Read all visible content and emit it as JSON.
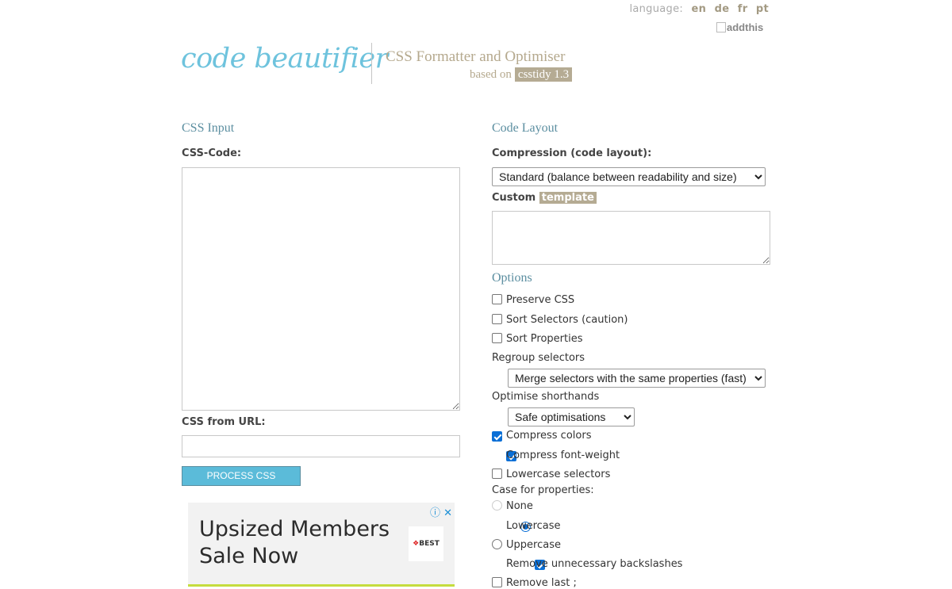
{
  "language": {
    "label": "language:",
    "options": [
      "en",
      "de",
      "fr",
      "pt"
    ]
  },
  "addthis": {
    "alt": "addthis"
  },
  "header": {
    "logo": "code beautifier",
    "subtitle": "CSS Formatter and Optimiser",
    "based_on": "based on",
    "based_tag": "csstidy 1.3"
  },
  "input": {
    "heading": "CSS Input",
    "code_label": "CSS-Code:",
    "code_value": "",
    "url_label": "CSS from URL:",
    "url_value": "",
    "process_button": "PROCESS CSS"
  },
  "ad": {
    "title": "Upsized Members Sale Now",
    "brand": "BEST",
    "info_icon": "info-icon",
    "close_icon": "close-icon"
  },
  "layout": {
    "heading": "Code Layout",
    "compression_label": "Compression (code layout):",
    "compression_selected": "Standard (balance between readability and size)",
    "custom_label": "Custom",
    "custom_tag": "template",
    "custom_value": ""
  },
  "options": {
    "heading": "Options",
    "preserve_css": {
      "label": "Preserve CSS",
      "checked": false
    },
    "sort_selectors": {
      "label": "Sort Selectors (caution)",
      "checked": false
    },
    "sort_properties": {
      "label": "Sort Properties",
      "checked": false
    },
    "regroup_label": "Regroup selectors",
    "regroup_selected": "Merge selectors with the same properties (fast)",
    "optimise_label": "Optimise shorthands",
    "optimise_selected": "Safe optimisations",
    "compress_colors": {
      "label": "Compress colors",
      "checked": true
    },
    "compress_font_weight": {
      "label": "Compress font-weight",
      "checked": true
    },
    "lowercase_selectors": {
      "label": "Lowercase selectors",
      "checked": false
    },
    "case_label": "Case for properties:",
    "case_none": "None",
    "case_lowercase": "Lowercase",
    "case_uppercase": "Uppercase",
    "remove_backslashes": {
      "label": "Remove unnecessary backslashes",
      "checked": true
    },
    "remove_last": {
      "label": "Remove last ;",
      "checked": false
    }
  }
}
